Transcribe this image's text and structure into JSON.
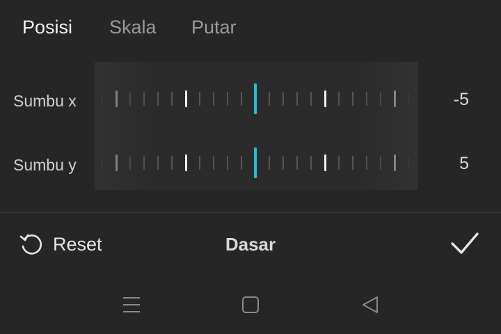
{
  "tabs": [
    {
      "label": "Posisi",
      "active": true
    },
    {
      "label": "Skala",
      "active": false
    },
    {
      "label": "Putar",
      "active": false
    }
  ],
  "axes": [
    {
      "label": "Sumbu x",
      "value": "-5"
    },
    {
      "label": "Sumbu y",
      "value": "5"
    }
  ],
  "footer": {
    "reset_label": "Reset",
    "title": "Dasar",
    "confirm_icon": "checkmark-icon"
  },
  "navbar": {
    "icons": [
      "menu-icon",
      "home-icon",
      "back-icon"
    ]
  },
  "colors": {
    "background": "#262626",
    "accent": "#1ec0d8",
    "active_text": "#f2f2f2",
    "inactive_text": "#9a9a9a"
  }
}
